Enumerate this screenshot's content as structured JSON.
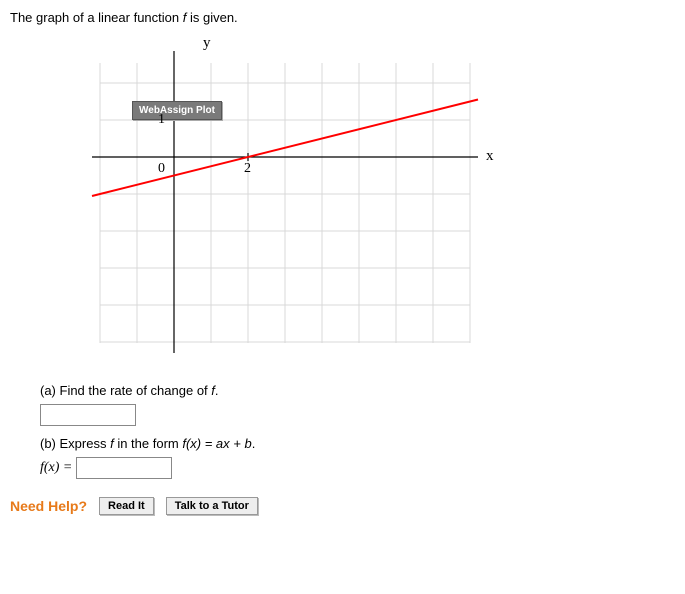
{
  "prompt": {
    "lead": "The graph of a linear function ",
    "fn": "f",
    "tail": " is given."
  },
  "chart_data": {
    "type": "line",
    "title": "WebAssign Plot",
    "xlabel": "x",
    "ylabel": "y",
    "xlim": [
      -2,
      8
    ],
    "ylim": [
      -5,
      2
    ],
    "xticks": [
      2
    ],
    "yticks": [
      0,
      1
    ],
    "series": [
      {
        "name": "f",
        "color": "#ff0000",
        "points": [
          [
            -2,
            -1
          ],
          [
            8,
            1.5
          ]
        ]
      }
    ],
    "note": "line passes through (0,-0.5) and (2,0); slope 0.25"
  },
  "parts": {
    "a": {
      "label": "(a) Find the rate of change of ",
      "fn": "f",
      "tail": "."
    },
    "b": {
      "label_lead": "(b) Express ",
      "fn": "f",
      "label_mid": " in the form  ",
      "form": "f(x) = ax + b",
      "tail": ".",
      "answer_prefix": "f(x) ="
    }
  },
  "help": {
    "label": "Need Help?",
    "read": "Read It",
    "tutor": "Talk to a Tutor"
  }
}
